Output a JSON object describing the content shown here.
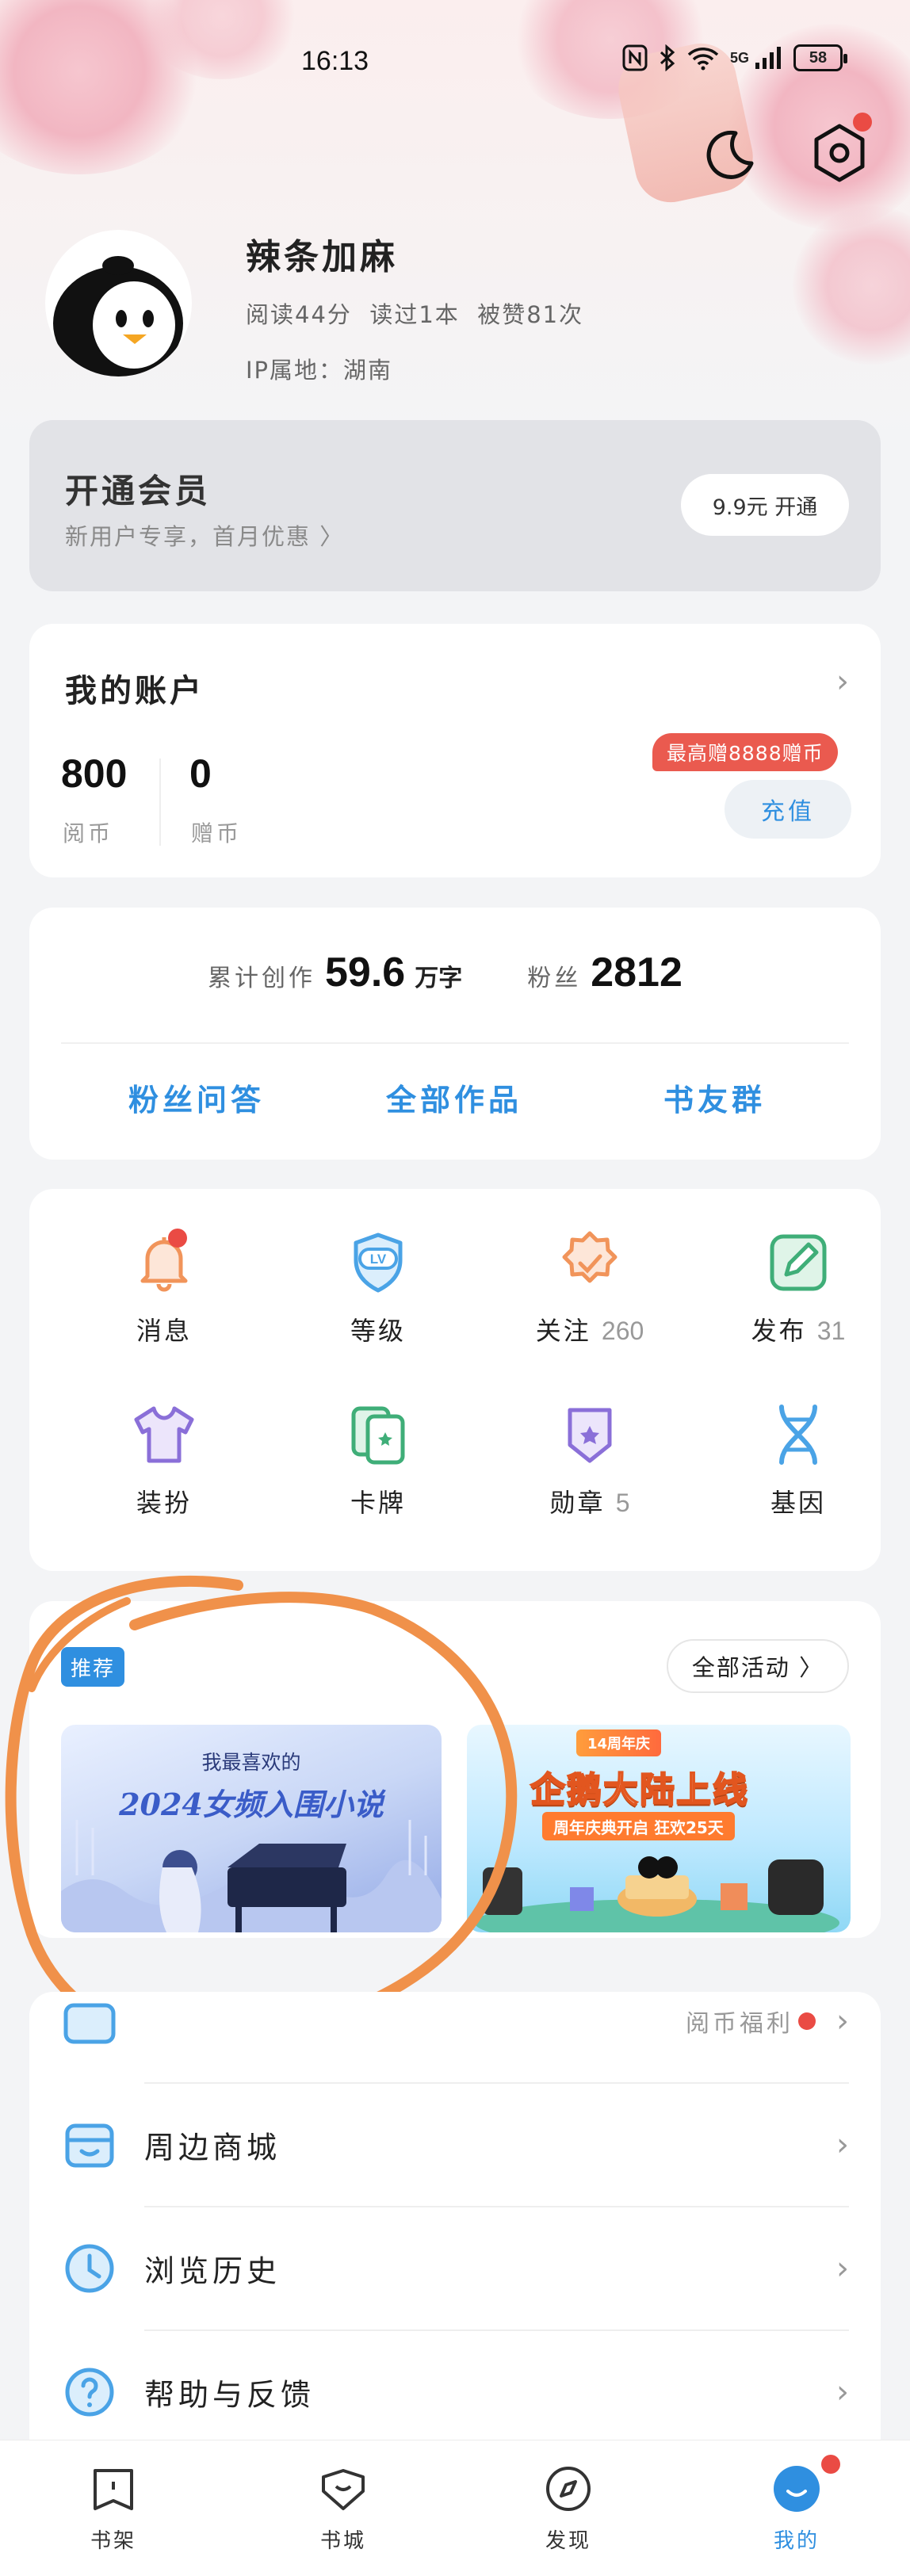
{
  "status_bar": {
    "time": "16:13",
    "network": "5G",
    "battery": "58"
  },
  "profile": {
    "name": "辣条加麻",
    "stats": "阅读44分  读过1本  被赞81次",
    "ip_location": "IP属地：湖南"
  },
  "vip": {
    "title": "开通会员",
    "subtitle": "新用户专享，首月优惠 〉",
    "button": "9.9元 开通"
  },
  "account": {
    "title": "我的账户",
    "read_coins": {
      "value": "800",
      "label": "阅币"
    },
    "gift_coins": {
      "value": "0",
      "label": "赠币"
    },
    "promo_badge": "最高赠8888赠币",
    "recharge_button": "充值"
  },
  "creator": {
    "total_label": "累计创作",
    "total_value": "59.6",
    "total_unit": "万字",
    "fans_label": "粉丝",
    "fans_value": "2812",
    "links": [
      "粉丝问答",
      "全部作品",
      "书友群"
    ]
  },
  "grid": [
    {
      "label": "消息",
      "count": "",
      "icon": "bell-icon"
    },
    {
      "label": "等级",
      "count": "",
      "icon": "level-icon"
    },
    {
      "label": "关注",
      "count": "260",
      "icon": "follow-badge-icon"
    },
    {
      "label": "发布",
      "count": "31",
      "icon": "edit-icon"
    },
    {
      "label": "装扮",
      "count": "",
      "icon": "shirt-icon"
    },
    {
      "label": "卡牌",
      "count": "",
      "icon": "cards-icon"
    },
    {
      "label": "勋章",
      "count": "5",
      "icon": "medal-icon"
    },
    {
      "label": "基因",
      "count": "",
      "icon": "dna-icon"
    }
  ],
  "activities": {
    "tag": "推荐",
    "all_button": "全部活动 〉",
    "banner1": {
      "line1": "我最喜欢的",
      "line2": "2024女频入围小说"
    },
    "banner2": {
      "badge": "14周年庆",
      "title": "企鹅大陆上线",
      "subtitle": "周年庆典开启 狂欢25天"
    }
  },
  "menu": {
    "partial_row_right": "阅币福利",
    "items": [
      "周边商城",
      "浏览历史",
      "帮助与反馈"
    ]
  },
  "tabbar": [
    "书架",
    "书城",
    "发现",
    "我的"
  ],
  "colors": {
    "accent_blue": "#2f8fe0",
    "badge_red": "#ea4b44",
    "annotation_orange": "#f0914a",
    "icon_orange": "#f1945a",
    "icon_blue": "#4aa3e6",
    "icon_green": "#3fae78",
    "icon_purple": "#8a6fd8"
  }
}
